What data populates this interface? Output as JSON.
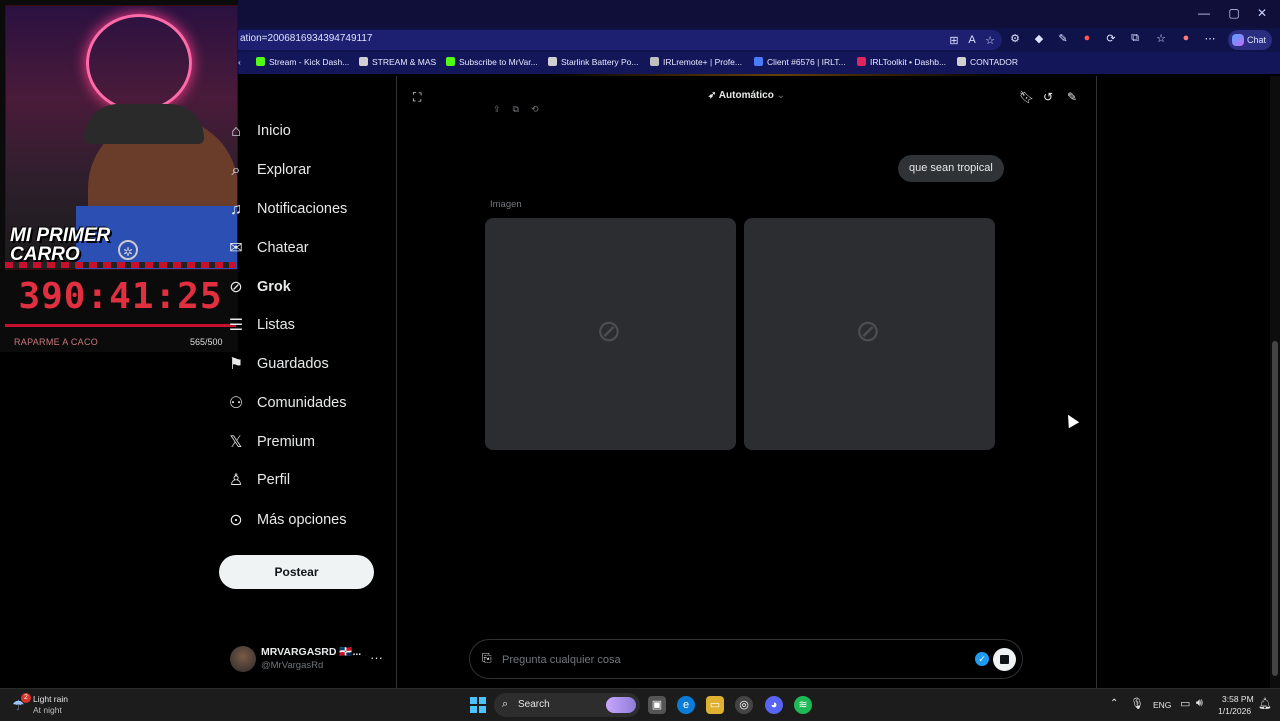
{
  "browser": {
    "url_fragment": "ation=2006816934394749117",
    "chat_label": "Chat",
    "window_controls": [
      "—",
      "▢",
      "✕"
    ],
    "bookmarks": [
      {
        "label": "Stream - Kick Dash...",
        "color": "#53fc18"
      },
      {
        "label": "STREAM & MAS",
        "color": "#d0d0d0"
      },
      {
        "label": "Subscribe to MrVar...",
        "color": "#53fc18"
      },
      {
        "label": "Starlink Battery Po...",
        "color": "#d0d0d0"
      },
      {
        "label": "IRLremote+ | Profe...",
        "color": "#c0c0c0"
      },
      {
        "label": "Client #6576 | IRLT...",
        "color": "#4a7cff"
      },
      {
        "label": "IRLToolkit • Dashb...",
        "color": "#e0245e"
      },
      {
        "label": "CONTADOR",
        "color": "#d0d0d0"
      }
    ]
  },
  "overlay": {
    "title": "MI PRIMER CARRO",
    "timer": "390:41:25",
    "goal_label": "RAPARME A CACO",
    "goal_count": "565/500"
  },
  "sidebar": {
    "items": [
      {
        "label": "Inicio",
        "icon": "home-icon"
      },
      {
        "label": "Explorar",
        "icon": "search-icon"
      },
      {
        "label": "Notificaciones",
        "icon": "bell-icon"
      },
      {
        "label": "Chatear",
        "icon": "mail-icon"
      },
      {
        "label": "Grok",
        "icon": "grok-icon",
        "active": true
      },
      {
        "label": "Listas",
        "icon": "list-icon"
      },
      {
        "label": "Guardados",
        "icon": "bookmark-icon"
      },
      {
        "label": "Comunidades",
        "icon": "communities-icon"
      },
      {
        "label": "Premium",
        "icon": "x-logo-icon"
      },
      {
        "label": "Perfil",
        "icon": "profile-icon"
      },
      {
        "label": "Más opciones",
        "icon": "more-icon"
      }
    ],
    "post_label": "Postear",
    "account": {
      "name": "MRVARGASRD 🇩🇴...",
      "handle": "@MrVargasRd"
    }
  },
  "grok": {
    "mode": "Automático",
    "user_message": "que sean tropical",
    "image_label": "Imagen",
    "input_placeholder": "Pregunta cualquier cosa",
    "image_count": 2
  },
  "taskbar": {
    "weather_badge": "2",
    "weather_line1": "Light rain",
    "weather_line2": "At night",
    "search_label": "Search",
    "language": "ENG",
    "time": "3:58 PM",
    "date": "1/1/2026"
  },
  "colors": {
    "accent": "#1d9bf0",
    "timer": "#e03040",
    "browser_chrome": "#10124a"
  }
}
